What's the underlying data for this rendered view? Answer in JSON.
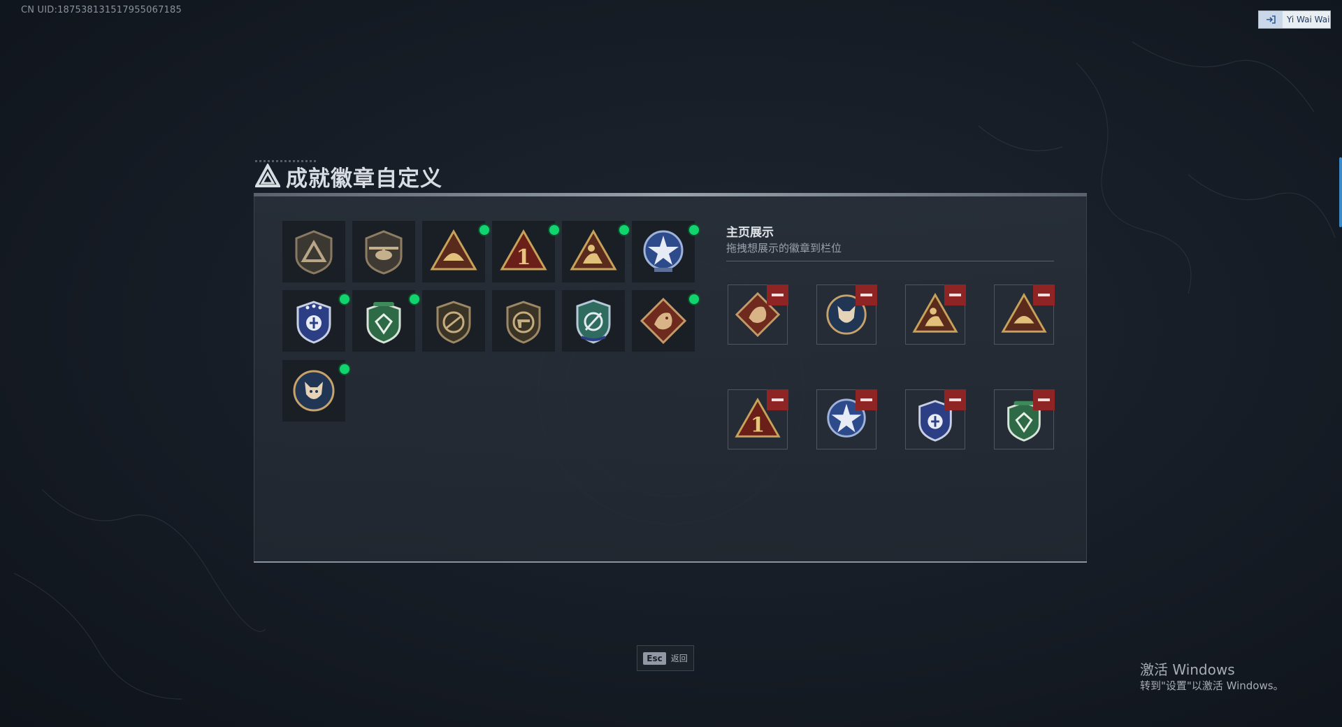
{
  "header": {
    "uid_text": "CN UID:187538131517955067185",
    "user_name": "Yi Wai Wai",
    "user_icon": "login-switch-icon"
  },
  "page": {
    "title": "成就徽章自定义",
    "title_icon": "delta-triangle-logo-icon"
  },
  "owned_badges": [
    {
      "icon": "triangle-shield-badge-icon",
      "is_new": false
    },
    {
      "icon": "helicopter-shield-badge-icon",
      "is_new": false
    },
    {
      "icon": "gold-hand-triangle-badge-icon",
      "is_new": true
    },
    {
      "icon": "number-one-triangle-badge-icon",
      "is_new": true
    },
    {
      "icon": "gold-figure-triangle-badge-icon",
      "is_new": true
    },
    {
      "icon": "blue-star-emblem-badge-icon",
      "is_new": true
    },
    {
      "icon": "blue-wings-shield-badge-icon",
      "is_new": true
    },
    {
      "icon": "green-gem-shield-badge-icon",
      "is_new": true
    },
    {
      "icon": "no-rifle-shield-badge-icon",
      "is_new": false
    },
    {
      "icon": "no-pistol-shield-badge-icon",
      "is_new": false
    },
    {
      "icon": "green-anchor-shield-badge-icon",
      "is_new": false
    },
    {
      "icon": "dragon-diamond-badge-icon",
      "is_new": true
    },
    {
      "icon": "wolf-medallion-badge-icon",
      "is_new": true
    }
  ],
  "display_section": {
    "title": "主页展示",
    "subtitle": "拖拽想展示的徽章到栏位",
    "slots": [
      {
        "icon": "dragon-diamond-badge-icon"
      },
      {
        "icon": "wolf-medallion-badge-icon"
      },
      {
        "icon": "gold-figure-triangle-badge-icon"
      },
      {
        "icon": "gold-hand-triangle-badge-icon"
      },
      {
        "icon": "number-one-triangle-badge-icon"
      },
      {
        "icon": "blue-star-emblem-badge-icon"
      },
      {
        "icon": "blue-wings-shield-badge-icon"
      },
      {
        "icon": "green-gem-shield-badge-icon"
      }
    ]
  },
  "footer": {
    "esc_key": "Esc",
    "esc_label": "返回"
  },
  "watermark": {
    "title": "激活 Windows",
    "subtitle": "转到\"设置\"以激活 Windows。"
  },
  "colors": {
    "new_indicator": "#12d46f",
    "remove_button": "#8e2424",
    "panel_background": "#262c35"
  }
}
